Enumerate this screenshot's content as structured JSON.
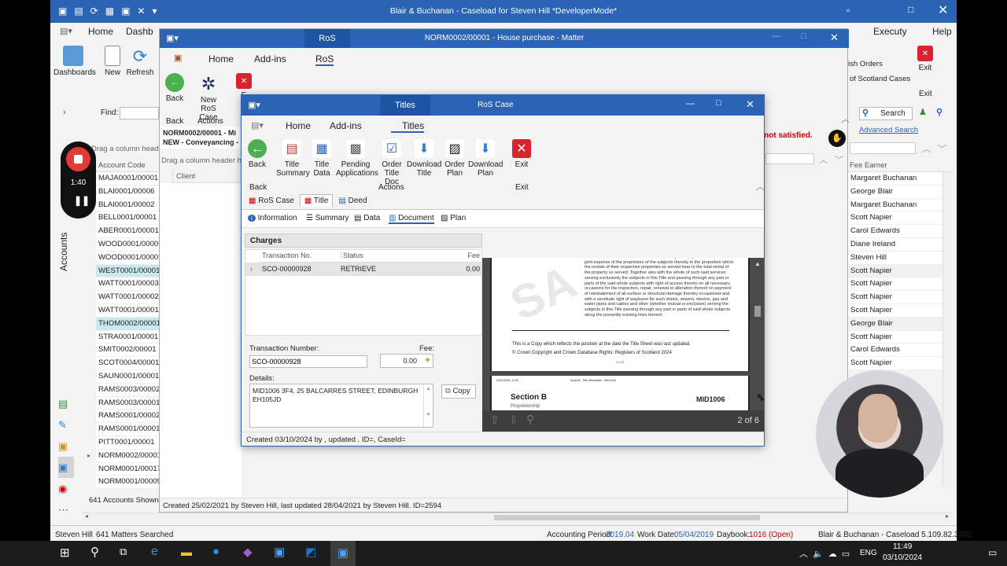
{
  "main": {
    "title": "Blair & Buchanan - Caseload for Steven Hill *DeveloperMode*",
    "menus": [
      "Home",
      "Dashb"
    ],
    "ribbon": {
      "dashboards": "Dashboards",
      "new": "New",
      "refresh": "Refresh",
      "find": "Find:"
    },
    "right_menus": [
      "Executy",
      "Help"
    ],
    "right_items": [
      "ish Orders",
      "of Scotland Cases",
      "Exit",
      "Exit"
    ],
    "search": "Search",
    "advanced_search": "Advanced Search",
    "fee_earner_header": "Fee Earner",
    "fee_earners": [
      "Margaret Buchanan",
      "George Blair",
      "Margaret Buchanan",
      "Scott Napier",
      "Carol Edwards",
      "Diane Ireland",
      "Steven Hill",
      "Scott Napier",
      "Scott Napier",
      "Scott Napier",
      "Scott Napier",
      "George Blair",
      "Scott Napier",
      "Carol Edwards",
      "Scott Napier"
    ],
    "drag_hint": "Drag a column header he",
    "account_header": "Account Code",
    "accounts": [
      "MAJA0001/00001",
      "BLAI0001/00006",
      "BLAI0001/00002",
      "BELL0001/00001",
      "ABER0001/00001",
      "WOOD0001/00009",
      "WOOD0001/00001",
      "WEST0001/00001",
      "WATT0001/00003",
      "WATT0001/00002",
      "WATT0001/00001",
      "THOM0002/00001",
      "STRA0001/00001",
      "SMIT0002/00001",
      "SCOT0004/00001",
      "SAUN0001/00001",
      "RAMS0003/00002",
      "RAMS0003/00001",
      "RAMS0001/00002",
      "RAMS0001/00001",
      "PITT0001/00001",
      "NORM0002/00001",
      "NORM0001/00017",
      "NORM0001/00009"
    ],
    "accounts_shown": "641 Accounts Shown",
    "side_label": "Accounts",
    "recording_time": "1:40",
    "not_satisfied": "not satisfied.",
    "matter_footer": "Created 25/02/2021 by Steven Hill, last updated 28/04/2021 by Steven Hill. ID=2594",
    "status": {
      "user": "Steven Hill",
      "matters": "641 Matters Searched",
      "acc_period_label": "Accounting Period:",
      "acc_period": "2019.04",
      "work_date_label": "Work Date:",
      "work_date": "05/04/2019",
      "daybook_label": "Daybook:",
      "daybook": "1016 (Open)",
      "version": "Blair & Buchanan - Caseload 5.109.82.3392"
    }
  },
  "matter": {
    "tab": "RoS",
    "title": "NORM0002/00001 - House purchase - Matter",
    "menus": [
      "Home",
      "Add-ins",
      "RoS"
    ],
    "buttons": {
      "back": "Back",
      "new_ros": "New RoS Case",
      "exit": "E"
    },
    "groups": {
      "back": "Back",
      "actions": "Actions"
    },
    "header1": "NORM0002/00001 - Mi",
    "header2": "NEW - Conveyancing -",
    "drag_hint": "Drag a column header here",
    "client": "Client"
  },
  "ros": {
    "tab": "Titles",
    "title": "RoS Case",
    "menus": [
      "Home",
      "Add-ins",
      "Titles"
    ],
    "buttons": [
      "Back",
      "Title Summary",
      "Title Data",
      "Pending Applications",
      "Order Title Doc",
      "Download Title",
      "Order Plan",
      "Download Plan",
      "Exit"
    ],
    "groups": {
      "back": "Back",
      "actions": "Actions",
      "exit": "Exit"
    },
    "tabs": [
      "RoS Case",
      "Title",
      "Deed"
    ],
    "subtabs": [
      "Information",
      "Summary",
      "Data",
      "Document",
      "Plan"
    ],
    "charges": "Charges",
    "columns": [
      "Transaction No.",
      "Status",
      "Fee"
    ],
    "row": {
      "tx": "SCO-00000928",
      "status": "RETRIEVE",
      "fee": "0.00"
    },
    "tx_label": "Transaction Number:",
    "tx_value": "SCO-00000928",
    "fee_label": "Fee:",
    "fee_value": "0.00",
    "details_label": "Details:",
    "details_value": "MID1006 3F4, 25 BALCARRES STREET, EDINBURGH EH105JD",
    "copy": "Copy",
    "doc": {
      "body": "said services so far as conduit in common being mutually maintained at the joint expense of the proprietors of the subjects thereby in the proportion which the rentals of their respective properties so served bear to the total rental of the property so served: Together also with the whole of such said services serving exclusively the subjects in this Title and passing through any part or parts of the said whole subjects with right of access thereto on all necessary occasions for the inspection, repair, renewal or alteration thereof on payment of reinstatement of all surface or structural damage thereby occasioned and with a servitude right of wayleave for such drains, sewers, electric, gas and water pipes and cables and other (whether mutual or exclusive) serving the subjects in this Title passing through any part or parts of said whole subjects along the presently existing lines thereof.",
      "copy_note": "This is a Copy which reflects the position at the date the Title Sheet was last updated.",
      "crown": "© Crown Copyright and Crown Database Rights: Registers of Scotland 2024",
      "page_small": "3 of 6",
      "p2_date": "03/10/2024, 11:49",
      "p2_mid": "ScotLIS - Title Information - MID1006",
      "section": "Section B",
      "mid": "MID1006",
      "proprietorship": "Proprietorship",
      "watermark": "SA",
      "page": "2 of 6"
    },
    "footer": "Created 03/10/2024 by , updated . ID=, CaseId="
  },
  "taskbar": {
    "time": "11:49",
    "date": "03/10/2024",
    "lang": "ENG"
  },
  "colors": {
    "accent": "#2b63b5",
    "selected": "#c9e9f0",
    "error": "#cc0000"
  }
}
